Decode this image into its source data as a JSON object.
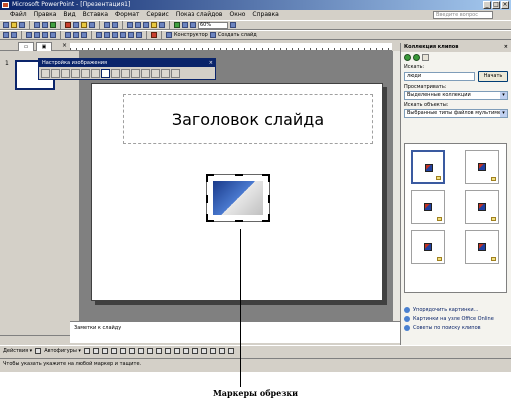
{
  "window": {
    "title": "Microsoft PowerPoint - [Презентация1]",
    "controls": [
      "_",
      "□",
      "×"
    ]
  },
  "menu": {
    "items": [
      "Файл",
      "Правка",
      "Вид",
      "Вставка",
      "Формат",
      "Сервис",
      "Показ слайдов",
      "Окно",
      "Справка"
    ],
    "help_placeholder": "Введите вопрос"
  },
  "toolbar": {
    "zoom": "60%",
    "designer_label": "Конструктор",
    "new_slide_label": "Создать слайд"
  },
  "picture_toolbar": {
    "title": "Настройка изображения",
    "close": "×"
  },
  "slides": {
    "number": "1",
    "close": "×"
  },
  "slide": {
    "title": "Заголовок слайда"
  },
  "notes": {
    "placeholder": "Заметки к слайду"
  },
  "drawing_toolbar": {
    "actions_label": "Действия ▾",
    "autoshapes_label": "Автофигуры ▾"
  },
  "status": {
    "text": "Чтобы указать укажите на любой маркер и тащите."
  },
  "task_pane": {
    "title": "Коллекция клипов",
    "close": "×",
    "search_label": "Искать:",
    "search_value": "люди",
    "search_button": "Начать",
    "browse_label": "Просматривать:",
    "browse_value": "Выделенные коллекции",
    "find_label": "Искать объекты:",
    "find_value": "Выбранные типы файлов мультимед",
    "links": [
      "Упорядочить картинки...",
      "Картинки на узле Office Online",
      "Советы по поиску клипов"
    ]
  },
  "caption": {
    "text": "Маркеры обрезки"
  }
}
